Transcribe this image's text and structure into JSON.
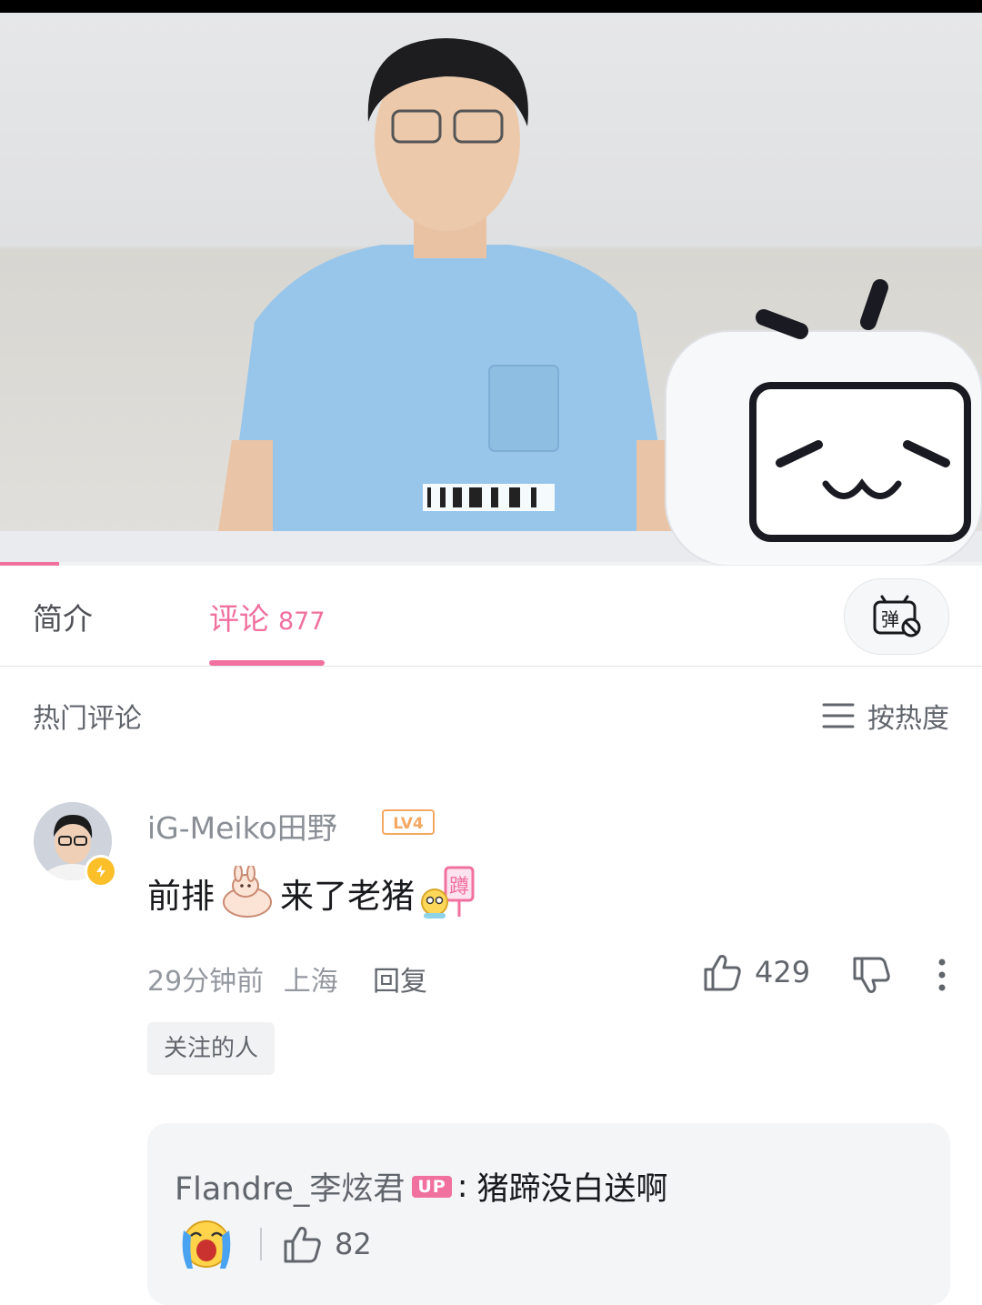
{
  "tabs": {
    "intro_label": "简介",
    "comments_label": "评论",
    "comments_count": "877",
    "danmaku_icon": "danmaku-toggle-icon"
  },
  "comments_header": {
    "title": "热门评论",
    "sort_label": "按热度",
    "sort_icon": "menu-lines-icon"
  },
  "comment": {
    "username": "iG-Meiko田野",
    "level": "LV4",
    "text_part1": "前排",
    "text_part2": "来了老猪",
    "emote1": "cute-rabbit-emote",
    "emote2": "squat-sign-emote",
    "time": "29分钟前",
    "location": "上海",
    "reply_label": "回复",
    "likes": "429",
    "tag": "关注的人"
  },
  "reply": {
    "username": "Flandre_李炫君",
    "badge": "UP",
    "separator": ":",
    "text": "猪蹄没白送啊",
    "emote": "crying-face-emote",
    "likes": "82"
  },
  "video": {
    "progress": 0.06
  },
  "colors": {
    "accent": "#f0709e",
    "text_primary": "#18191c",
    "text_secondary": "#61666d",
    "text_tertiary": "#9499a0",
    "level_badge": "#f5a862"
  }
}
